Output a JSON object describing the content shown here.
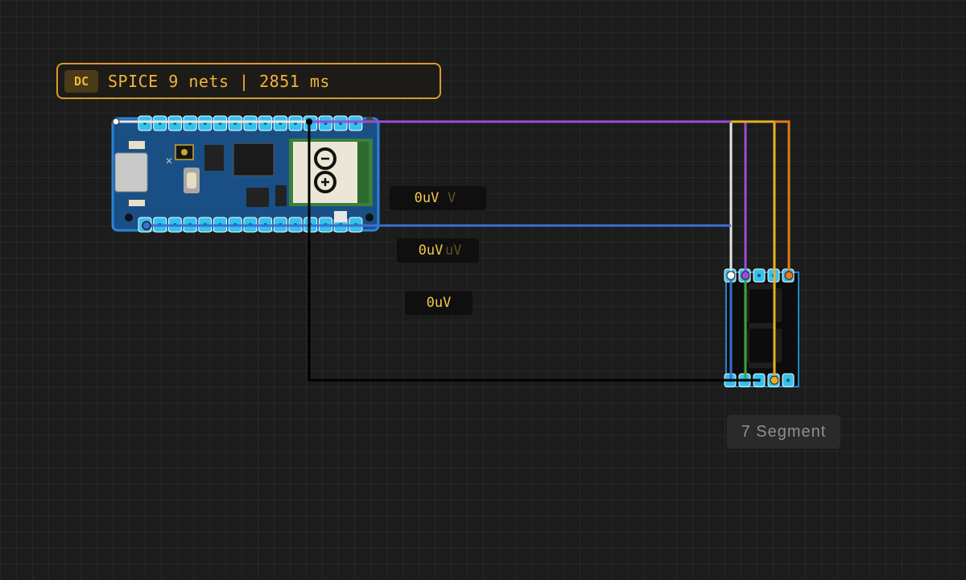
{
  "status": {
    "mode": "DC",
    "text": "SPICE 9 nets | 2851 ms"
  },
  "probes": [
    {
      "value": "0uV",
      "ghost": "V"
    },
    {
      "value": "0uV",
      "ghost": "uV"
    },
    {
      "value": "0uV"
    }
  ],
  "components": {
    "arduino": {
      "name": "arduino-nano",
      "logo_icon": "infinity-logo-icon"
    },
    "seven_segment": {
      "label": "7 Segment"
    }
  },
  "wire_colors": {
    "white": "#e6e6e6",
    "purple": "#9b4dd8",
    "yellow": "#e8b020",
    "orange": "#e07a1c",
    "blue": "#3a6fd4",
    "green": "#3aa63a",
    "black": "#000000"
  }
}
